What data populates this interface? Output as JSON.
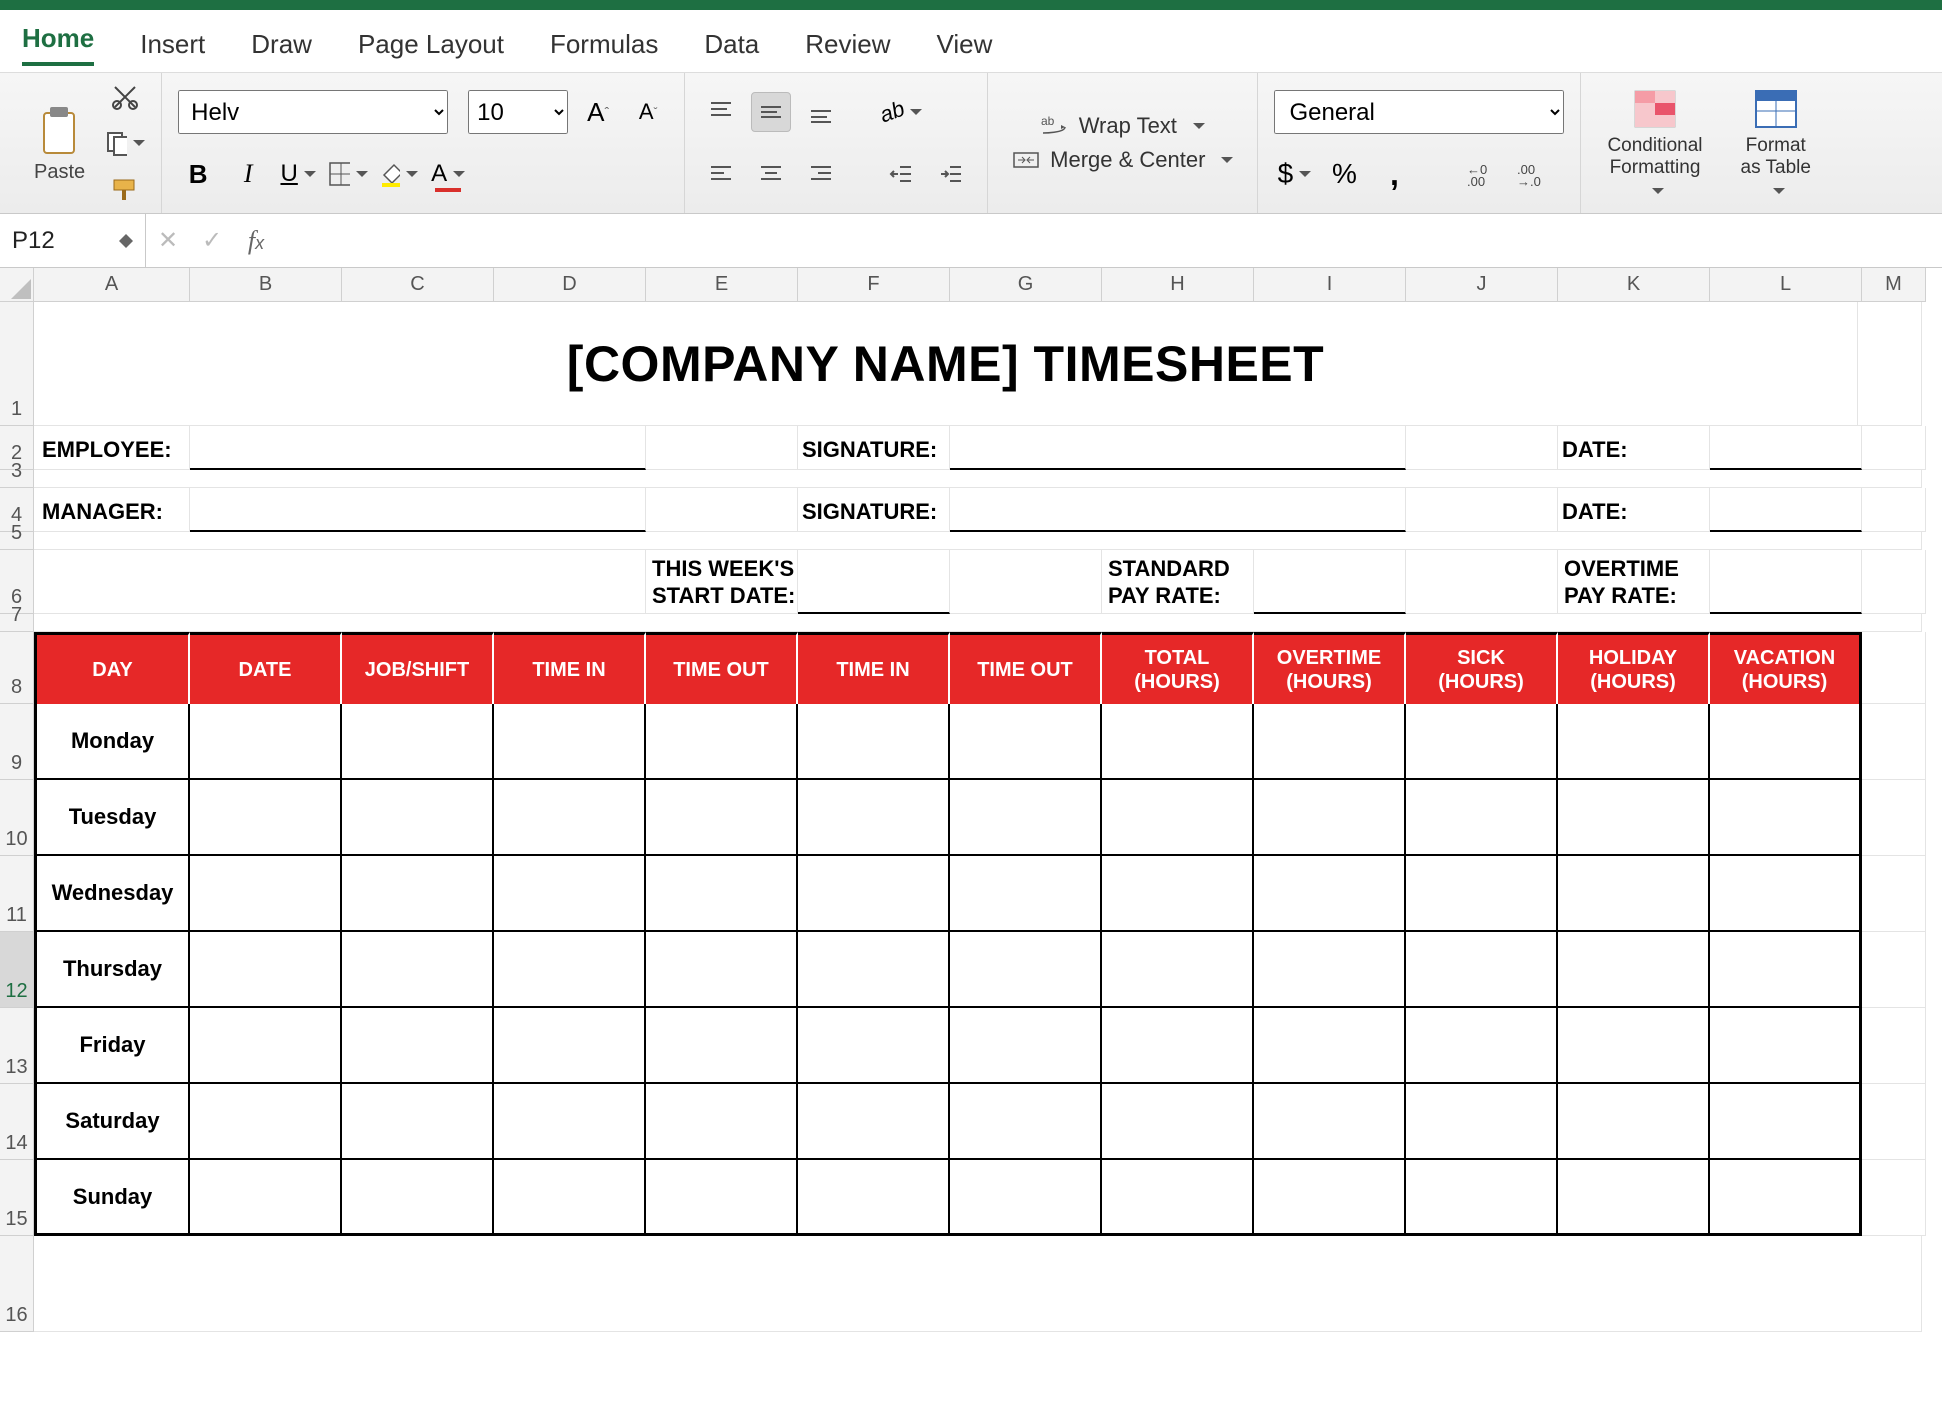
{
  "app": {
    "name": "Excel"
  },
  "tabs": [
    "Home",
    "Insert",
    "Draw",
    "Page Layout",
    "Formulas",
    "Data",
    "Review",
    "View"
  ],
  "active_tab": "Home",
  "clipboard": {
    "paste": "Paste"
  },
  "font": {
    "name": "Helv",
    "size": "10",
    "bold": "B",
    "italic": "I",
    "underline": "U"
  },
  "alignment": {
    "wrap_text": "Wrap Text",
    "merge_center": "Merge & Center"
  },
  "number": {
    "format": "General"
  },
  "styles": {
    "conditional": "Conditional\nFormatting",
    "as_table": "Format\nas Table"
  },
  "namebox": "P12",
  "formula": "",
  "columns": [
    "A",
    "B",
    "C",
    "D",
    "E",
    "F",
    "G",
    "H",
    "I",
    "J",
    "K",
    "L",
    "M"
  ],
  "rows": [
    "1",
    "2",
    "3",
    "4",
    "5",
    "6",
    "7",
    "8",
    "9",
    "10",
    "11",
    "12",
    "13",
    "14",
    "15",
    "16"
  ],
  "sheet": {
    "title": "[COMPANY NAME] TIMESHEET",
    "employee_lbl": "EMPLOYEE:",
    "manager_lbl": "MANAGER:",
    "signature_lbl": "SIGNATURE:",
    "date_lbl": "DATE:",
    "week_start_lbl": "THIS WEEK'S\nSTART DATE:",
    "std_rate_lbl": "STANDARD\nPAY RATE:",
    "ot_rate_lbl": "OVERTIME\nPAY RATE:",
    "headers": [
      "DAY",
      "DATE",
      "JOB/SHIFT",
      "TIME IN",
      "TIME OUT",
      "TIME IN",
      "TIME OUT",
      "TOTAL\n(HOURS)",
      "OVERTIME\n(HOURS)",
      "SICK\n(HOURS)",
      "HOLIDAY\n(HOURS)",
      "VACATION\n(HOURS)"
    ],
    "days": [
      "Monday",
      "Tuesday",
      "Wednesday",
      "Thursday",
      "Friday",
      "Saturday",
      "Sunday"
    ]
  }
}
